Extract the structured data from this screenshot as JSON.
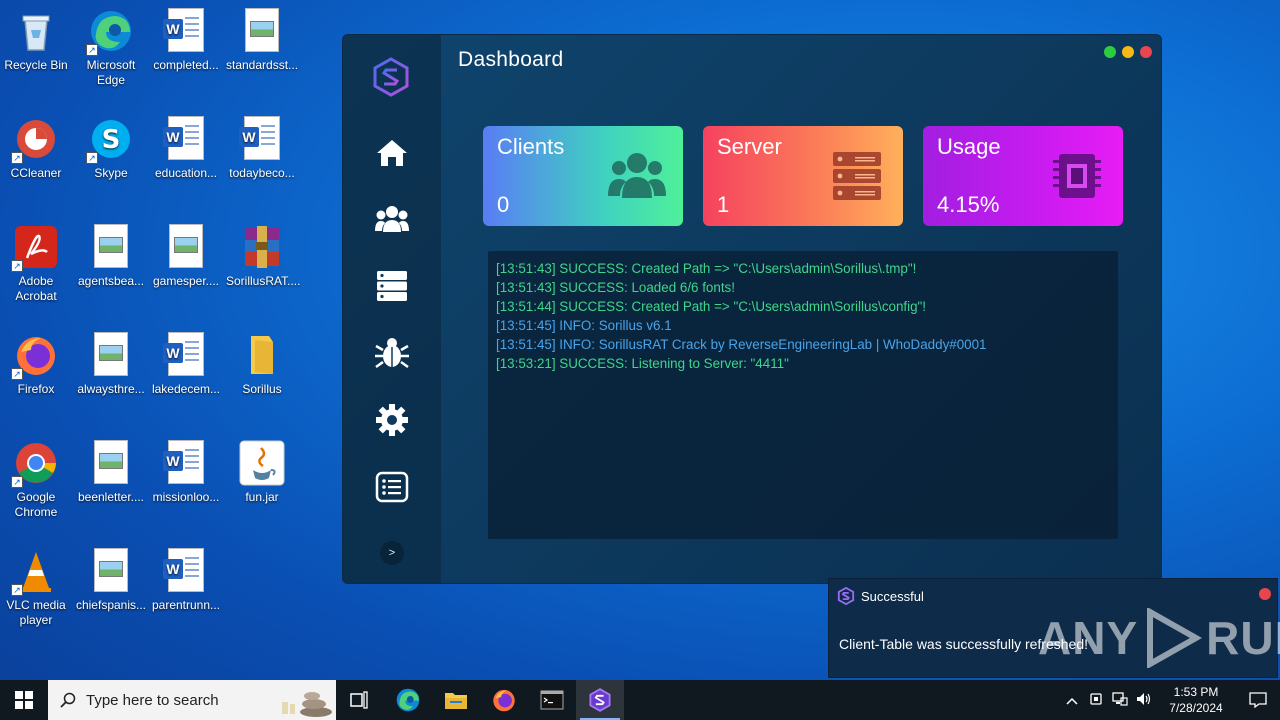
{
  "desktop": {
    "icons": [
      {
        "label": "Recycle Bin"
      },
      {
        "label": "Microsoft Edge"
      },
      {
        "label": "completed..."
      },
      {
        "label": "standardsst..."
      },
      {
        "label": "CCleaner"
      },
      {
        "label": "Skype"
      },
      {
        "label": "education..."
      },
      {
        "label": "todaybeco..."
      },
      {
        "label": "Adobe Acrobat"
      },
      {
        "label": "agentsbea..."
      },
      {
        "label": "gamesper...."
      },
      {
        "label": "SorillusRAT...."
      },
      {
        "label": "Firefox"
      },
      {
        "label": "alwaysthre..."
      },
      {
        "label": "lakedecem..."
      },
      {
        "label": "Sorillus"
      },
      {
        "label": "Google Chrome"
      },
      {
        "label": "beenletter...."
      },
      {
        "label": "missionloo..."
      },
      {
        "label": "fun.jar"
      },
      {
        "label": "VLC media player"
      },
      {
        "label": "chiefspanis..."
      },
      {
        "label": "parentrunn..."
      }
    ]
  },
  "app": {
    "title": "Dashboard",
    "expand_label": ">",
    "colors": {
      "accent": "#8a5cf6",
      "green_dot": "#2ecc40",
      "yellow_dot": "#f5b915",
      "red_dot": "#e8454e"
    },
    "cards": [
      {
        "title": "Clients",
        "value": "0",
        "icon": "users-icon"
      },
      {
        "title": "Server",
        "value": "1",
        "icon": "server-icon"
      },
      {
        "title": "Usage",
        "value": "4.15%",
        "icon": "cpu-icon"
      }
    ],
    "console": [
      {
        "text": "[13:51:43] SUCCESS: Created Path => \"C:\\Users\\admin\\Sorillus\\.tmp\"!",
        "level": "success"
      },
      {
        "text": "[13:51:43] SUCCESS: Loaded 6/6 fonts!",
        "level": "success"
      },
      {
        "text": "[13:51:44] SUCCESS: Created Path => \"C:\\Users\\admin\\Sorillus\\config\"!",
        "level": "success"
      },
      {
        "text": "[13:51:45] INFO: Sorillus v6.1",
        "level": "info"
      },
      {
        "text": "[13:51:45] INFO: SorillusRAT Crack by ReverseEngineeringLab | WhoDaddy#0001",
        "level": "info"
      },
      {
        "text": "[13:53:21] SUCCESS: Listening to Server: \"4411\"",
        "level": "success"
      }
    ]
  },
  "toast": {
    "title": "Successful",
    "message": "Client-Table was successfully refreshed!"
  },
  "watermark": {
    "text1": "ANY",
    "text2": "RUN"
  },
  "taskbar": {
    "search_placeholder": "Type here to search",
    "time": "1:53 PM",
    "date": "7/28/2024"
  }
}
